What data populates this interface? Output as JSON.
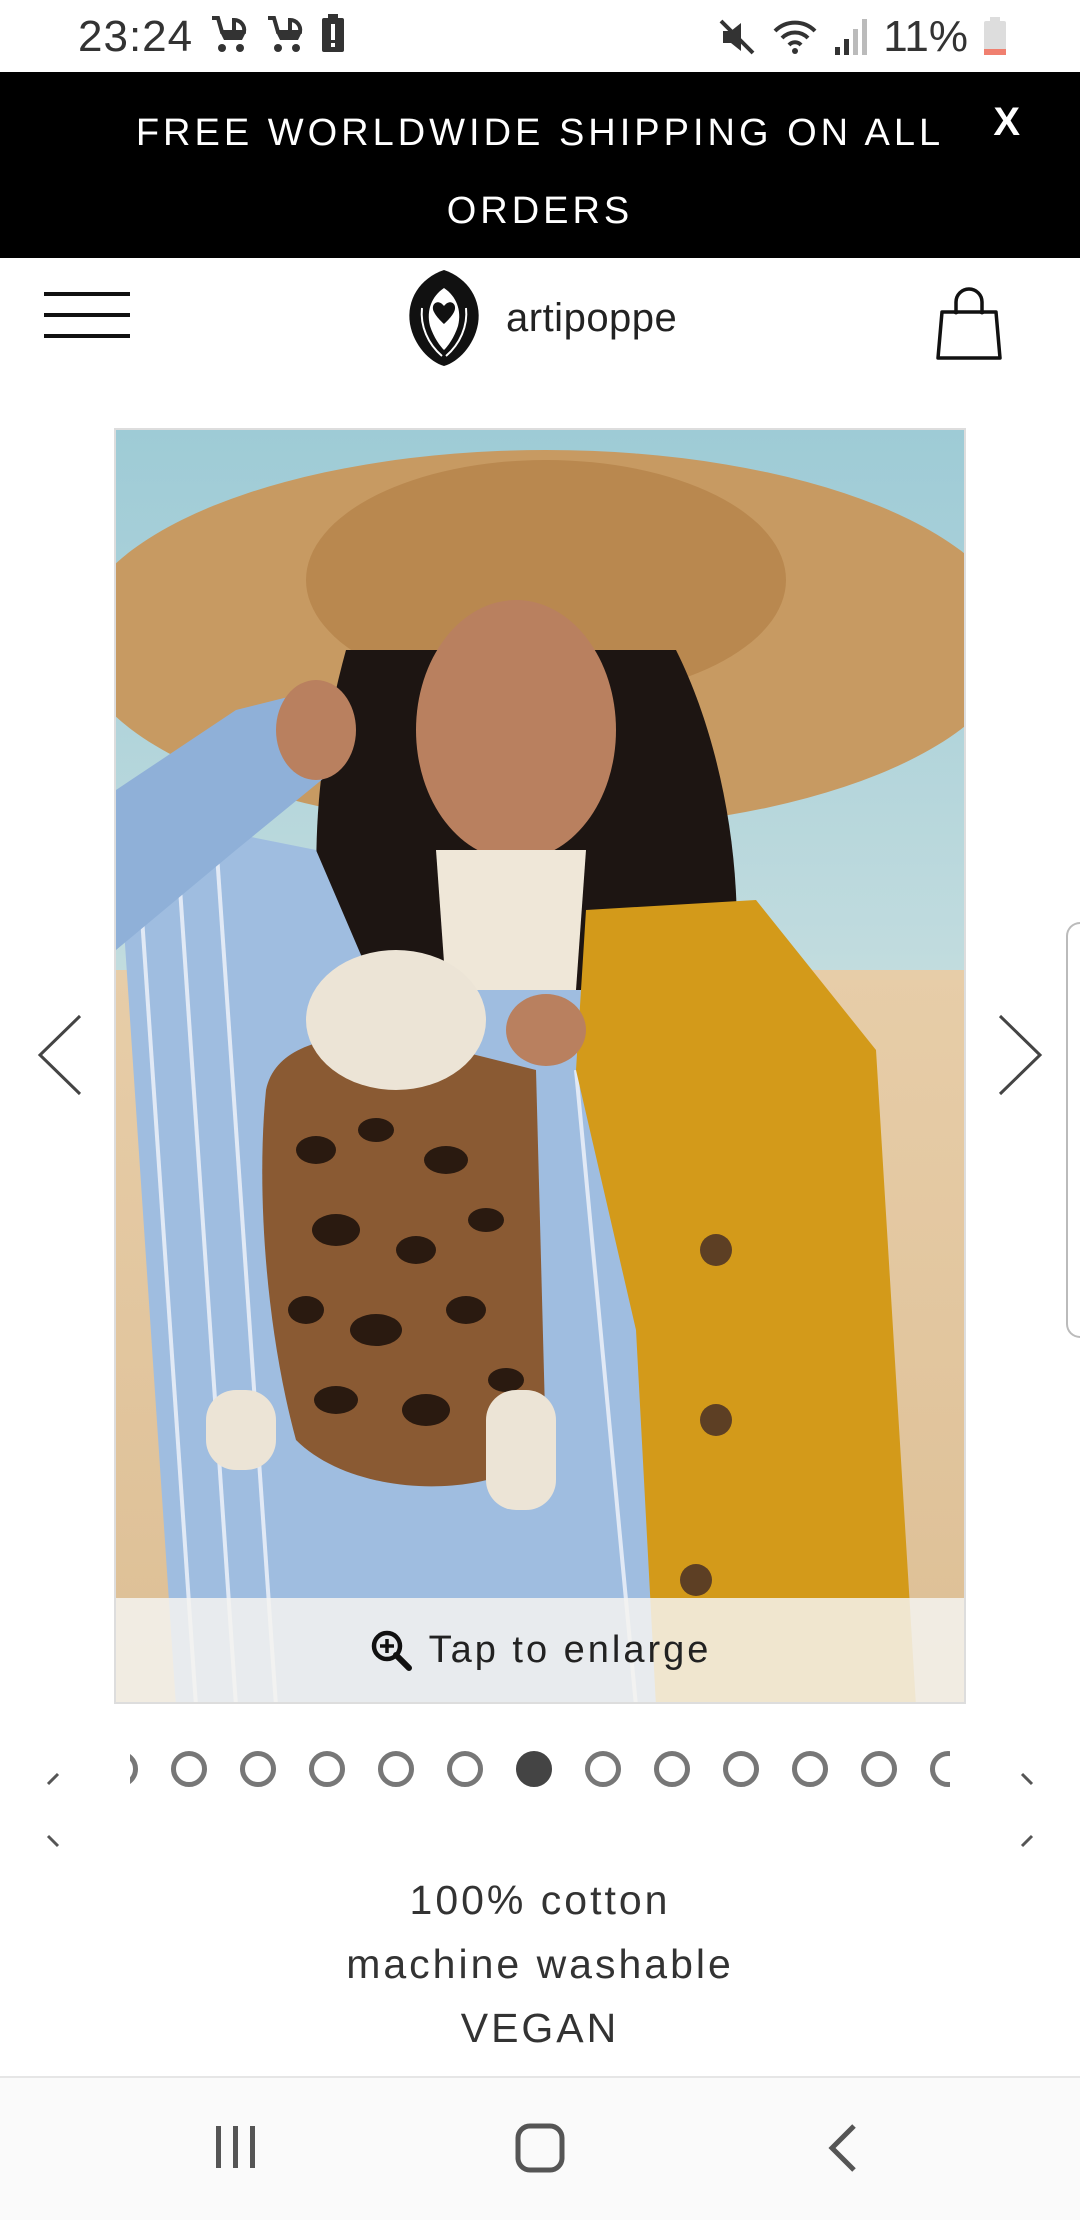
{
  "status_bar": {
    "time": "23:24",
    "battery_percent": "11%",
    "left_icons": [
      "stroller-icon",
      "stroller-icon",
      "battery-alert-icon"
    ],
    "right_icons": [
      "mute-icon",
      "wifi-icon",
      "signal-icon",
      "battery-icon"
    ]
  },
  "promo_banner": {
    "text": "FREE WORLDWIDE SHIPPING ON ALL ORDERS",
    "close_label": "X",
    "background": "#000000"
  },
  "header": {
    "brand_name": "artipoppe",
    "menu_icon": "hamburger-menu-icon",
    "cart_icon": "shopping-bag-icon"
  },
  "product_gallery": {
    "enlarge_label": "Tap to enlarge",
    "enlarge_icon": "zoom-in-icon",
    "total_dots": 12,
    "active_dot_index": 6
  },
  "features": {
    "line1": "100% cotton",
    "line2": "machine washable",
    "line3": "VEGAN"
  },
  "nav_bar": {
    "buttons": [
      "recent-apps-icon",
      "home-icon",
      "back-icon"
    ]
  }
}
